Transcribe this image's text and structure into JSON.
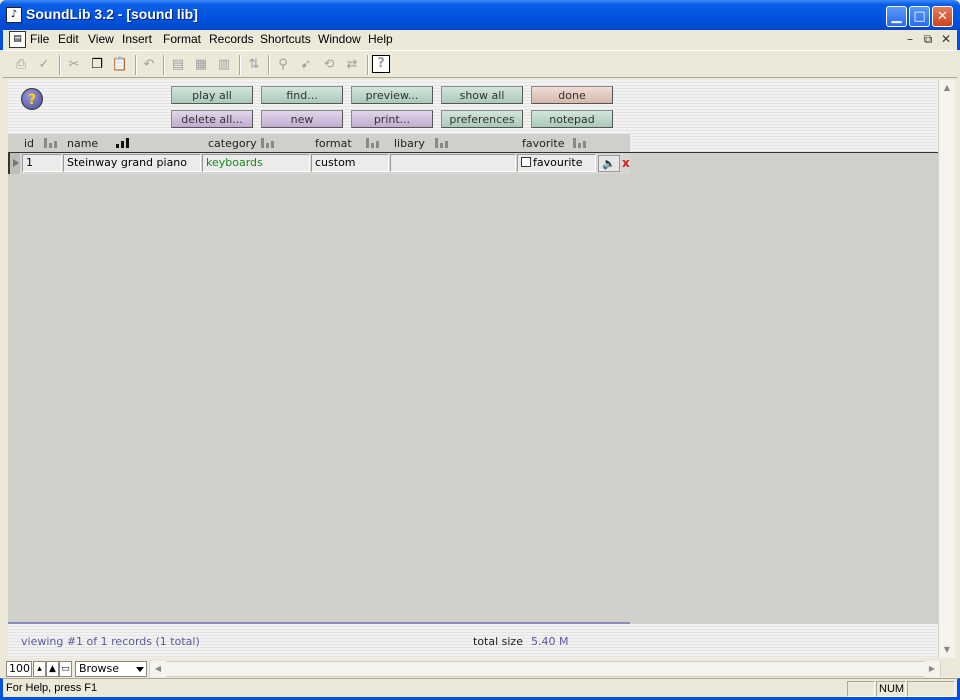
{
  "window": {
    "title": "SoundLib 3.2 - [sound lib]",
    "icon": "app-icon",
    "minimize": "▁",
    "maximize": "□",
    "close": "✕"
  },
  "menu": {
    "items": [
      "File",
      "Edit",
      "View",
      "Insert",
      "Format",
      "Records",
      "Shortcuts",
      "Window",
      "Help"
    ],
    "mdi": {
      "minimize": "–",
      "restore": "⧉",
      "close": "✕"
    }
  },
  "toolbar": {
    "buttons": [
      "print",
      "spell-check",
      "cut",
      "copy",
      "paste",
      "undo",
      "new-record",
      "duplicate-record",
      "delete-record",
      "sort",
      "find",
      "find-next",
      "replace",
      "relookup",
      "context-help"
    ],
    "help_glyph": "?"
  },
  "form": {
    "help_button": "?",
    "buttons_row1": [
      "play all",
      "find...",
      "preview...",
      "show all",
      "done"
    ],
    "buttons_row2": [
      "delete all...",
      "new",
      "print...",
      "preferences",
      "notepad"
    ]
  },
  "columns": [
    "id",
    "name",
    "category",
    "format",
    "libary",
    "favorite"
  ],
  "records": [
    {
      "id": "1",
      "name": "Steinway grand piano",
      "category": "keyboards",
      "format": "custom",
      "library": "",
      "favorite_label": "favourite",
      "favorite_checked": false
    }
  ],
  "speaker_glyph": "🔈",
  "delete_glyph": "x",
  "footer": {
    "viewing": "viewing #1 of 1 records (1 total)",
    "total_size_label": "total size",
    "total_size_value": "5.40 M"
  },
  "bottom": {
    "zoom": "100",
    "mode": "Browse"
  },
  "status": {
    "help_text": "For Help, press F1",
    "num": "NUM"
  },
  "colors": {
    "title_blue": "#0053e0",
    "category_green": "#1a8a1a",
    "footer_text": "#5a5aa0",
    "delete_red": "#d42020"
  }
}
